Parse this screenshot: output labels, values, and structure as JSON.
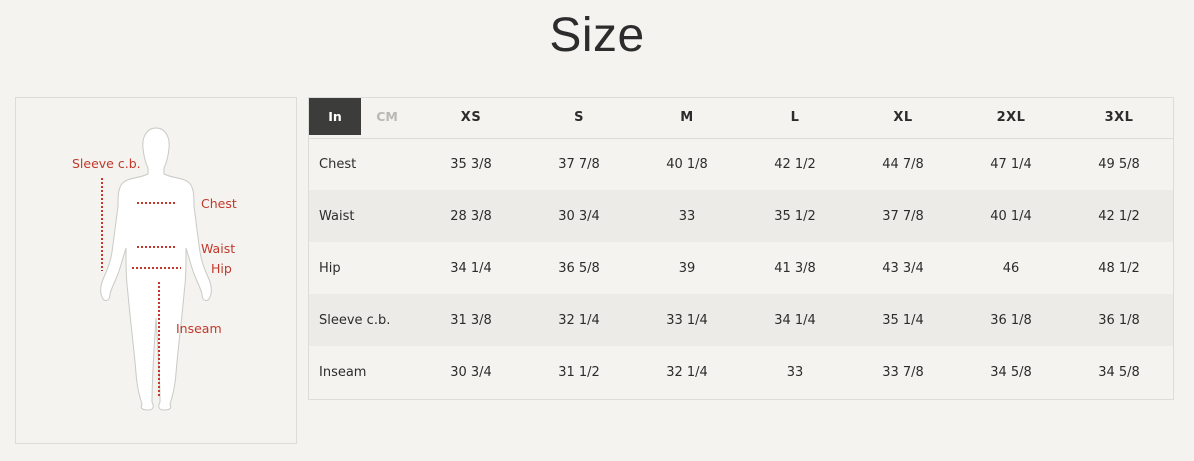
{
  "title": "Size",
  "figure": {
    "labels": {
      "sleeve": "Sleeve c.b.",
      "chest": "Chest",
      "waist": "Waist",
      "hip": "Hip",
      "inseam": "Inseam"
    },
    "accent_color": "#c0392b"
  },
  "units": {
    "active": "In",
    "inactive": "CM"
  },
  "sizes": [
    "XS",
    "S",
    "M",
    "L",
    "XL",
    "2XL",
    "3XL"
  ],
  "rows": [
    {
      "label": "Chest",
      "values": [
        "35 3/8",
        "37 7/8",
        "40 1/8",
        "42 1/2",
        "44 7/8",
        "47 1/4",
        "49 5/8"
      ]
    },
    {
      "label": "Waist",
      "values": [
        "28 3/8",
        "30 3/4",
        "33",
        "35 1/2",
        "37 7/8",
        "40 1/4",
        "42 1/2"
      ]
    },
    {
      "label": "Hip",
      "values": [
        "34 1/4",
        "36 5/8",
        "39",
        "41 3/8",
        "43 3/4",
        "46",
        "48 1/2"
      ]
    },
    {
      "label": "Sleeve c.b.",
      "values": [
        "31 3/8",
        "32 1/4",
        "33 1/4",
        "34 1/4",
        "35 1/4",
        "36 1/8",
        "36 1/8"
      ]
    },
    {
      "label": "Inseam",
      "values": [
        "30 3/4",
        "31 1/2",
        "32 1/4",
        "33",
        "33 7/8",
        "34 5/8",
        "34 5/8"
      ]
    }
  ]
}
